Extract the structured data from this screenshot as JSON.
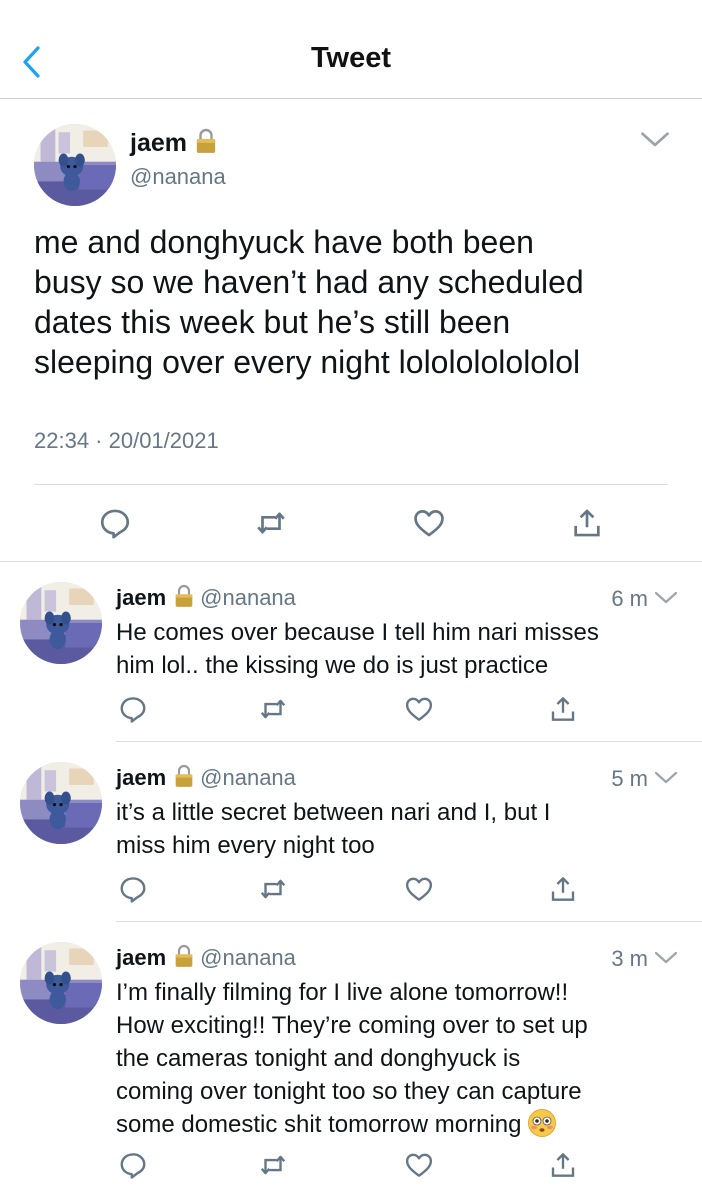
{
  "nav": {
    "title": "Tweet",
    "back_icon": "chevron-left-icon"
  },
  "colors": {
    "accent": "#1da1f2",
    "secondary_text": "#657786",
    "icon_gray": "#657786"
  },
  "main_tweet": {
    "name": "jaem",
    "handle": "@nanana",
    "text": "me and donghyuck have both been\nbusy so we haven’t had any scheduled\ndates this week but he’s still been\nsleeping over every night lololololololol",
    "timestamp": "22:34 · 20/01/2021"
  },
  "replies": [
    {
      "name": "jaem",
      "handle": "@nanana",
      "time": "6 m",
      "text": "He comes over because I tell him nari misses\nhim lol.. the kissing we do is just practice"
    },
    {
      "name": "jaem",
      "handle": "@nanana",
      "time": "5 m",
      "text": "it’s a little secret between nari and I, but I\nmiss him every night too"
    },
    {
      "name": "jaem",
      "handle": "@nanana",
      "time": "3 m",
      "text": "I’m finally filming for I live alone tomorrow!!\nHow exciting!! They’re coming over to set up\nthe cameras tonight and donghyuck is\ncoming over tonight too so they can capture\nsome domestic shit tomorrow morning",
      "emoji": "flushed-face-emoji"
    }
  ]
}
